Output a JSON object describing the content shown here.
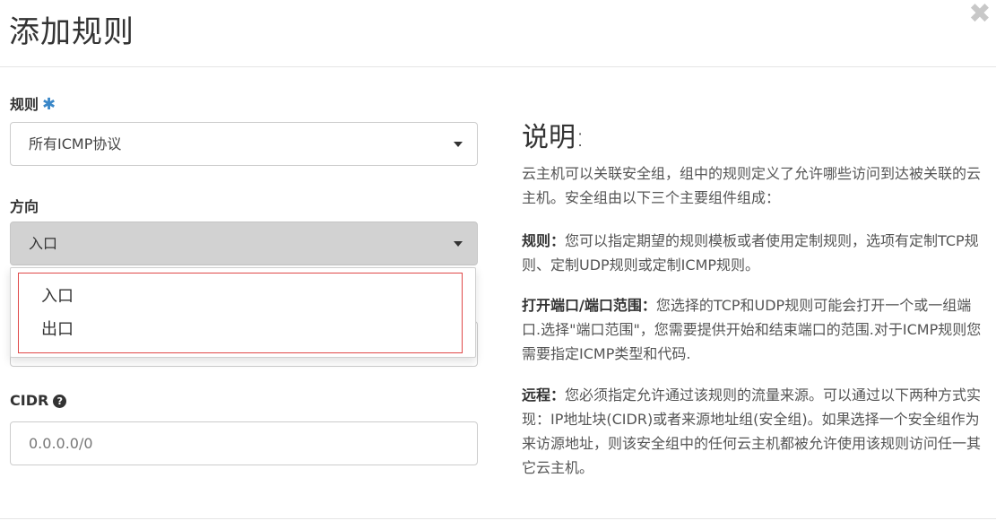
{
  "modal": {
    "title": "添加规则",
    "close_glyph": "✖"
  },
  "form": {
    "rule": {
      "label": "规则",
      "required_mark": "✱",
      "selected": "所有ICMP协议"
    },
    "direction": {
      "label": "方向",
      "selected": "入口",
      "options": [
        "入口",
        "出口"
      ]
    },
    "cidr": {
      "label": "CIDR",
      "help_glyph": "?",
      "placeholder": "0.0.0.0/0"
    }
  },
  "description": {
    "title": "说明:",
    "intro": "云主机可以关联安全组，组中的规则定义了允许哪些访问到达被关联的云主机。安全组由以下三个主要组件组成：",
    "rules_heading": "规则：",
    "rules_text": "您可以指定期望的规则模板或者使用定制规则，选项有定制TCP规则、定制UDP规则或定制ICMP规则。",
    "ports_heading": "打开端口/端口范围：",
    "ports_text": "您选择的TCP和UDP规则可能会打开一个或一组端口.选择\"端口范围\"，您需要提供开始和结束端口的范围.对于ICMP规则您需要指定ICMP类型和代码.",
    "remote_heading": "远程：",
    "remote_text": "您必须指定允许通过该规则的流量来源。可以通过以下两种方式实现：IP地址块(CIDR)或者来源地址组(安全组)。如果选择一个安全组作为来访源地址，则该安全组中的任何云主机都被允许使用该规则访问任一其它云主机。"
  },
  "colors": {
    "accent": "#3a87c8",
    "highlight_border": "#e04848",
    "open_select_bg": "#d2d2d2"
  }
}
